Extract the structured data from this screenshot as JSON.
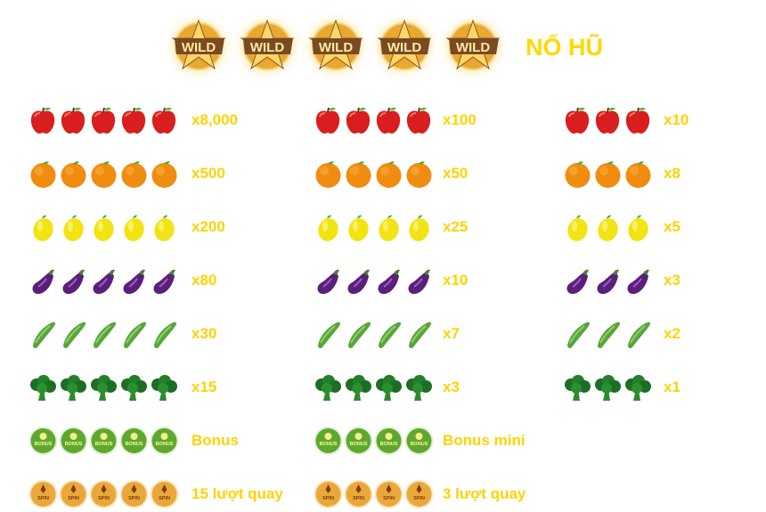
{
  "header": {
    "wild_symbol": "WILD",
    "wild_count": 5,
    "jackpot_label": "NỔ HŨ"
  },
  "colors": {
    "label": "#ffd200",
    "jackpot": "#ffd800"
  },
  "paytable": [
    {
      "symbol": "apple",
      "payouts": [
        {
          "count": 5,
          "label": "x8,000"
        },
        {
          "count": 4,
          "label": "x100"
        },
        {
          "count": 3,
          "label": "x10"
        }
      ]
    },
    {
      "symbol": "orange",
      "payouts": [
        {
          "count": 5,
          "label": "x500"
        },
        {
          "count": 4,
          "label": "x50"
        },
        {
          "count": 3,
          "label": "x8"
        }
      ]
    },
    {
      "symbol": "lemon",
      "payouts": [
        {
          "count": 5,
          "label": "x200"
        },
        {
          "count": 4,
          "label": "x25"
        },
        {
          "count": 3,
          "label": "x5"
        }
      ]
    },
    {
      "symbol": "eggplant",
      "payouts": [
        {
          "count": 5,
          "label": "x80"
        },
        {
          "count": 4,
          "label": "x10"
        },
        {
          "count": 3,
          "label": "x3"
        }
      ]
    },
    {
      "symbol": "cucumber",
      "payouts": [
        {
          "count": 5,
          "label": "x30"
        },
        {
          "count": 4,
          "label": "x7"
        },
        {
          "count": 3,
          "label": "x2"
        }
      ]
    },
    {
      "symbol": "broccoli",
      "payouts": [
        {
          "count": 5,
          "label": "x15"
        },
        {
          "count": 4,
          "label": "x3"
        },
        {
          "count": 3,
          "label": "x1"
        }
      ]
    },
    {
      "symbol": "bonus",
      "symbol_text": "BONUS",
      "payouts": [
        {
          "count": 5,
          "label": "Bonus"
        },
        {
          "count": 4,
          "label": "Bonus mini"
        }
      ]
    },
    {
      "symbol": "spin",
      "symbol_text": "SPIN",
      "payouts": [
        {
          "count": 5,
          "label": "15 lượt quay"
        },
        {
          "count": 4,
          "label": "3 lượt quay"
        }
      ]
    }
  ]
}
